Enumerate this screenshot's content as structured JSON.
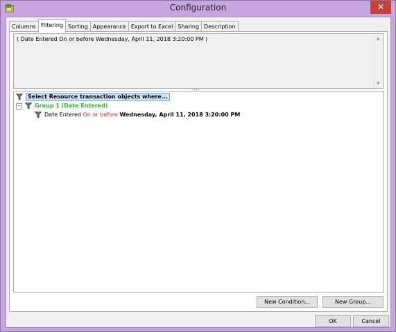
{
  "window": {
    "title": "Configuration",
    "close_glyph": "✕"
  },
  "tabs": [
    {
      "label": "Columns"
    },
    {
      "label": "Filtering"
    },
    {
      "label": "Sorting"
    },
    {
      "label": "Appearance"
    },
    {
      "label": "Export to Excel"
    },
    {
      "label": "Sharing"
    },
    {
      "label": "Description"
    }
  ],
  "active_tab": "Filtering",
  "summary": {
    "text": "( Date Entered On or before Wednesday, April 11, 2018 3:20:00 PM )"
  },
  "splitter_glyph": "....",
  "tree": {
    "root_label": "Select Resource transaction objects where...",
    "group": {
      "expander": "⊟",
      "label": "Group 1 (Date Entered)"
    },
    "condition": {
      "field": "Date Entered",
      "operator": "On or before",
      "value": "Wednesday, April 11, 2018 3:20:00 PM"
    }
  },
  "buttons": {
    "new_condition": "New Condition...",
    "new_group": "New Group...",
    "ok": "OK",
    "cancel": "Cancel"
  },
  "colors": {
    "titlebar": "#c7a6df",
    "close": "#c7403a",
    "group_label": "#2db52d",
    "operator": "#e02020",
    "selection": "#cce4f7"
  },
  "icons": {
    "app": "app-icon",
    "filter": "funnel-icon"
  }
}
